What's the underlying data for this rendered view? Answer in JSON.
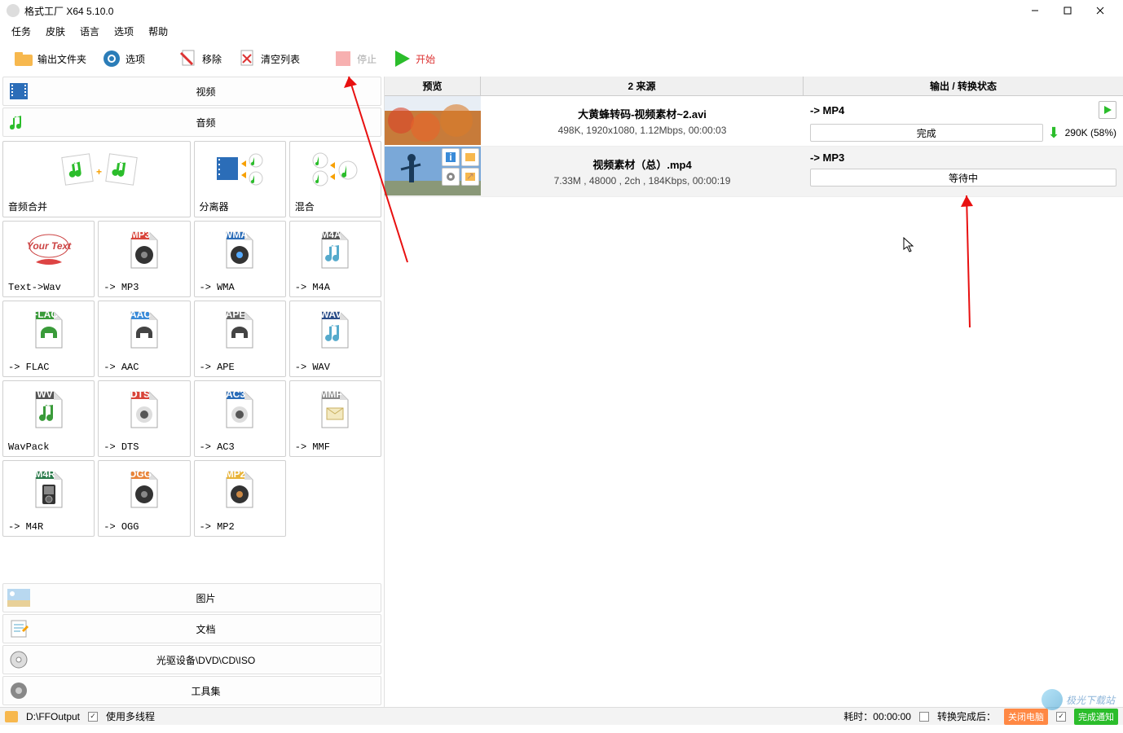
{
  "app": {
    "title": "格式工厂 X64 5.10.0"
  },
  "menu": {
    "task": "任务",
    "skin": "皮肤",
    "lang": "语言",
    "opts": "选项",
    "help": "帮助"
  },
  "toolbar": {
    "output": "输出文件夹",
    "options": "选项",
    "remove": "移除",
    "clear": "清空列表",
    "stop": "停止",
    "start": "开始"
  },
  "categories": {
    "video": "视频",
    "audio": "音频",
    "image": "图片",
    "doc": "文档",
    "disc": "光驱设备\\DVD\\CD\\ISO",
    "tools": "工具集"
  },
  "formats": {
    "merge": "音频合并",
    "split": "分离器",
    "mix": "混合",
    "txtwav": "Text->Wav",
    "mp3": "-> MP3",
    "wma": "-> WMA",
    "m4a": "-> M4A",
    "flac": "-> FLAC",
    "aac": "-> AAC",
    "ape": "-> APE",
    "wav": "-> WAV",
    "wavpack": "WavPack",
    "dts": "-> DTS",
    "ac3": "-> AC3",
    "mmf": "-> MMF",
    "m4r": "-> M4R",
    "ogg": "-> OGG",
    "mp2": "-> MP2"
  },
  "queue": {
    "headers": {
      "preview": "预览",
      "source": "2 来源",
      "status": "输出 / 转换状态"
    },
    "rows": [
      {
        "name": "大黄蜂转码-视频素材~2.avi",
        "info": "498K, 1920x1080, 1.12Mbps, 00:00:03",
        "target": "-> MP4",
        "status": "完成",
        "size": "290K  (58%)",
        "done": true
      },
      {
        "name": "视频素材（总）.mp4",
        "info": "7.33M , 48000 , 2ch , 184Kbps, 00:00:19",
        "target": "-> MP3",
        "status": "等待中",
        "done": false
      }
    ]
  },
  "statusbar": {
    "output": "D:\\FFOutput",
    "multithread": "使用多线程",
    "elapsed": "耗时：00:00:00",
    "after": "转换完成后：",
    "shutdown": "关闭电脑",
    "notify": "完成通知"
  }
}
